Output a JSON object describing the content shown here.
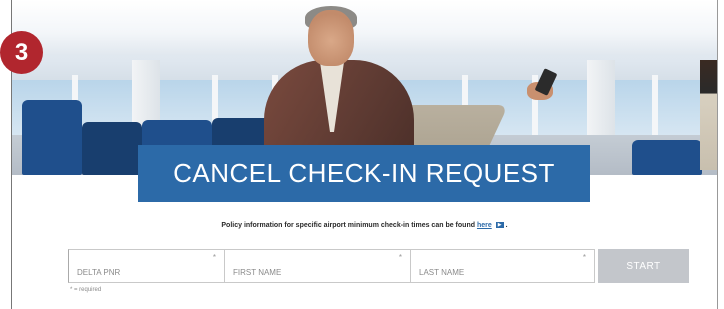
{
  "step_badge": "3",
  "banner": {
    "title": "CANCEL CHECK-IN REQUEST"
  },
  "policy": {
    "text": "Policy information for specific airport minimum check-in times can be found",
    "link": "here",
    "suffix": "."
  },
  "form": {
    "fields": [
      {
        "placeholder": "DELTA PNR",
        "required_mark": "*"
      },
      {
        "placeholder": "FIRST NAME",
        "required_mark": "*"
      },
      {
        "placeholder": "LAST NAME",
        "required_mark": "*"
      }
    ],
    "submit_label": "START",
    "required_note": "* = required"
  },
  "colors": {
    "brand_blue": "#2c6aa8",
    "badge_red": "#b1262e",
    "button_gray": "#c3c6cb"
  }
}
